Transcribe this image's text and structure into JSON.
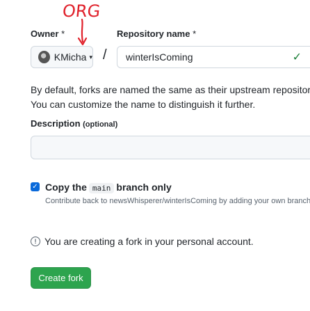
{
  "annotation": {
    "text": "ORG"
  },
  "owner": {
    "label": "Owner",
    "required_mark": " *",
    "value": "KMicha",
    "caret": "▾"
  },
  "separator": "/",
  "repository": {
    "label": "Repository name",
    "required_mark": " *",
    "value": "winterIsComing",
    "valid_icon": "✓"
  },
  "info_paragraph": "By default, forks are named the same as their upstream repository. You can customize the name to distinguish it further.",
  "description": {
    "label": "Description",
    "optional": "(optional)",
    "value": ""
  },
  "copy_branch": {
    "checked": true,
    "prefix": "Copy the",
    "branch": "main",
    "suffix": "branch only",
    "help": "Contribute back to newsWhisperer/winterIsComing by adding your own branch."
  },
  "notice": {
    "icon": "info-icon",
    "text": "You are creating a fork in your personal account."
  },
  "submit": {
    "label": "Create fork"
  },
  "colors": {
    "annotation": "#e0202a",
    "primary": "#2da44e",
    "checkbox": "#0969da",
    "valid": "#1a7f37"
  }
}
